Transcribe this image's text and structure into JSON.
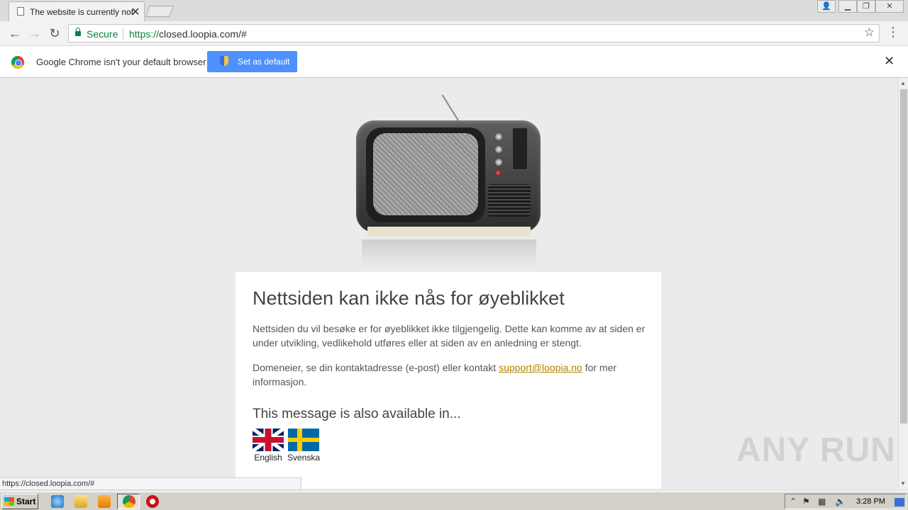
{
  "browser": {
    "tab_title": "The website is currently not available",
    "tab_close": "✕",
    "url_scheme": "https://",
    "url_rest": "closed.loopia.com/#",
    "secure_label": "Secure",
    "status_url": "https://closed.loopia.com/#"
  },
  "infobar": {
    "message": "Google Chrome isn't your default browser",
    "set_default_label": "Set as default",
    "close": "✕"
  },
  "page": {
    "heading": "Nettsiden kan ikke nås for øyeblikket",
    "paragraph1": "Nettsiden du vil besøke er for øyeblikket ikke tilgjengelig. Dette kan komme av at siden er under utvikling, vedlikehold utføres eller at siden av en anledning er stengt.",
    "paragraph2_before": "Domeneier, se din kontaktadresse (e-post) eller kontakt ",
    "support_email": "support@loopia.no",
    "paragraph2_after": " for mer informasjon.",
    "subheading": "This message is also available in...",
    "languages": [
      {
        "label": "English",
        "flag": "uk-flag"
      },
      {
        "label": "Svenska",
        "flag": "sweden-flag"
      }
    ]
  },
  "watermark": "ANY RUN",
  "taskbar": {
    "start_label": "Start",
    "clock": "3:28 PM"
  },
  "colors": {
    "accent_button": "#4d90fe",
    "secure_green": "#0b8043",
    "link": "#b38300"
  }
}
